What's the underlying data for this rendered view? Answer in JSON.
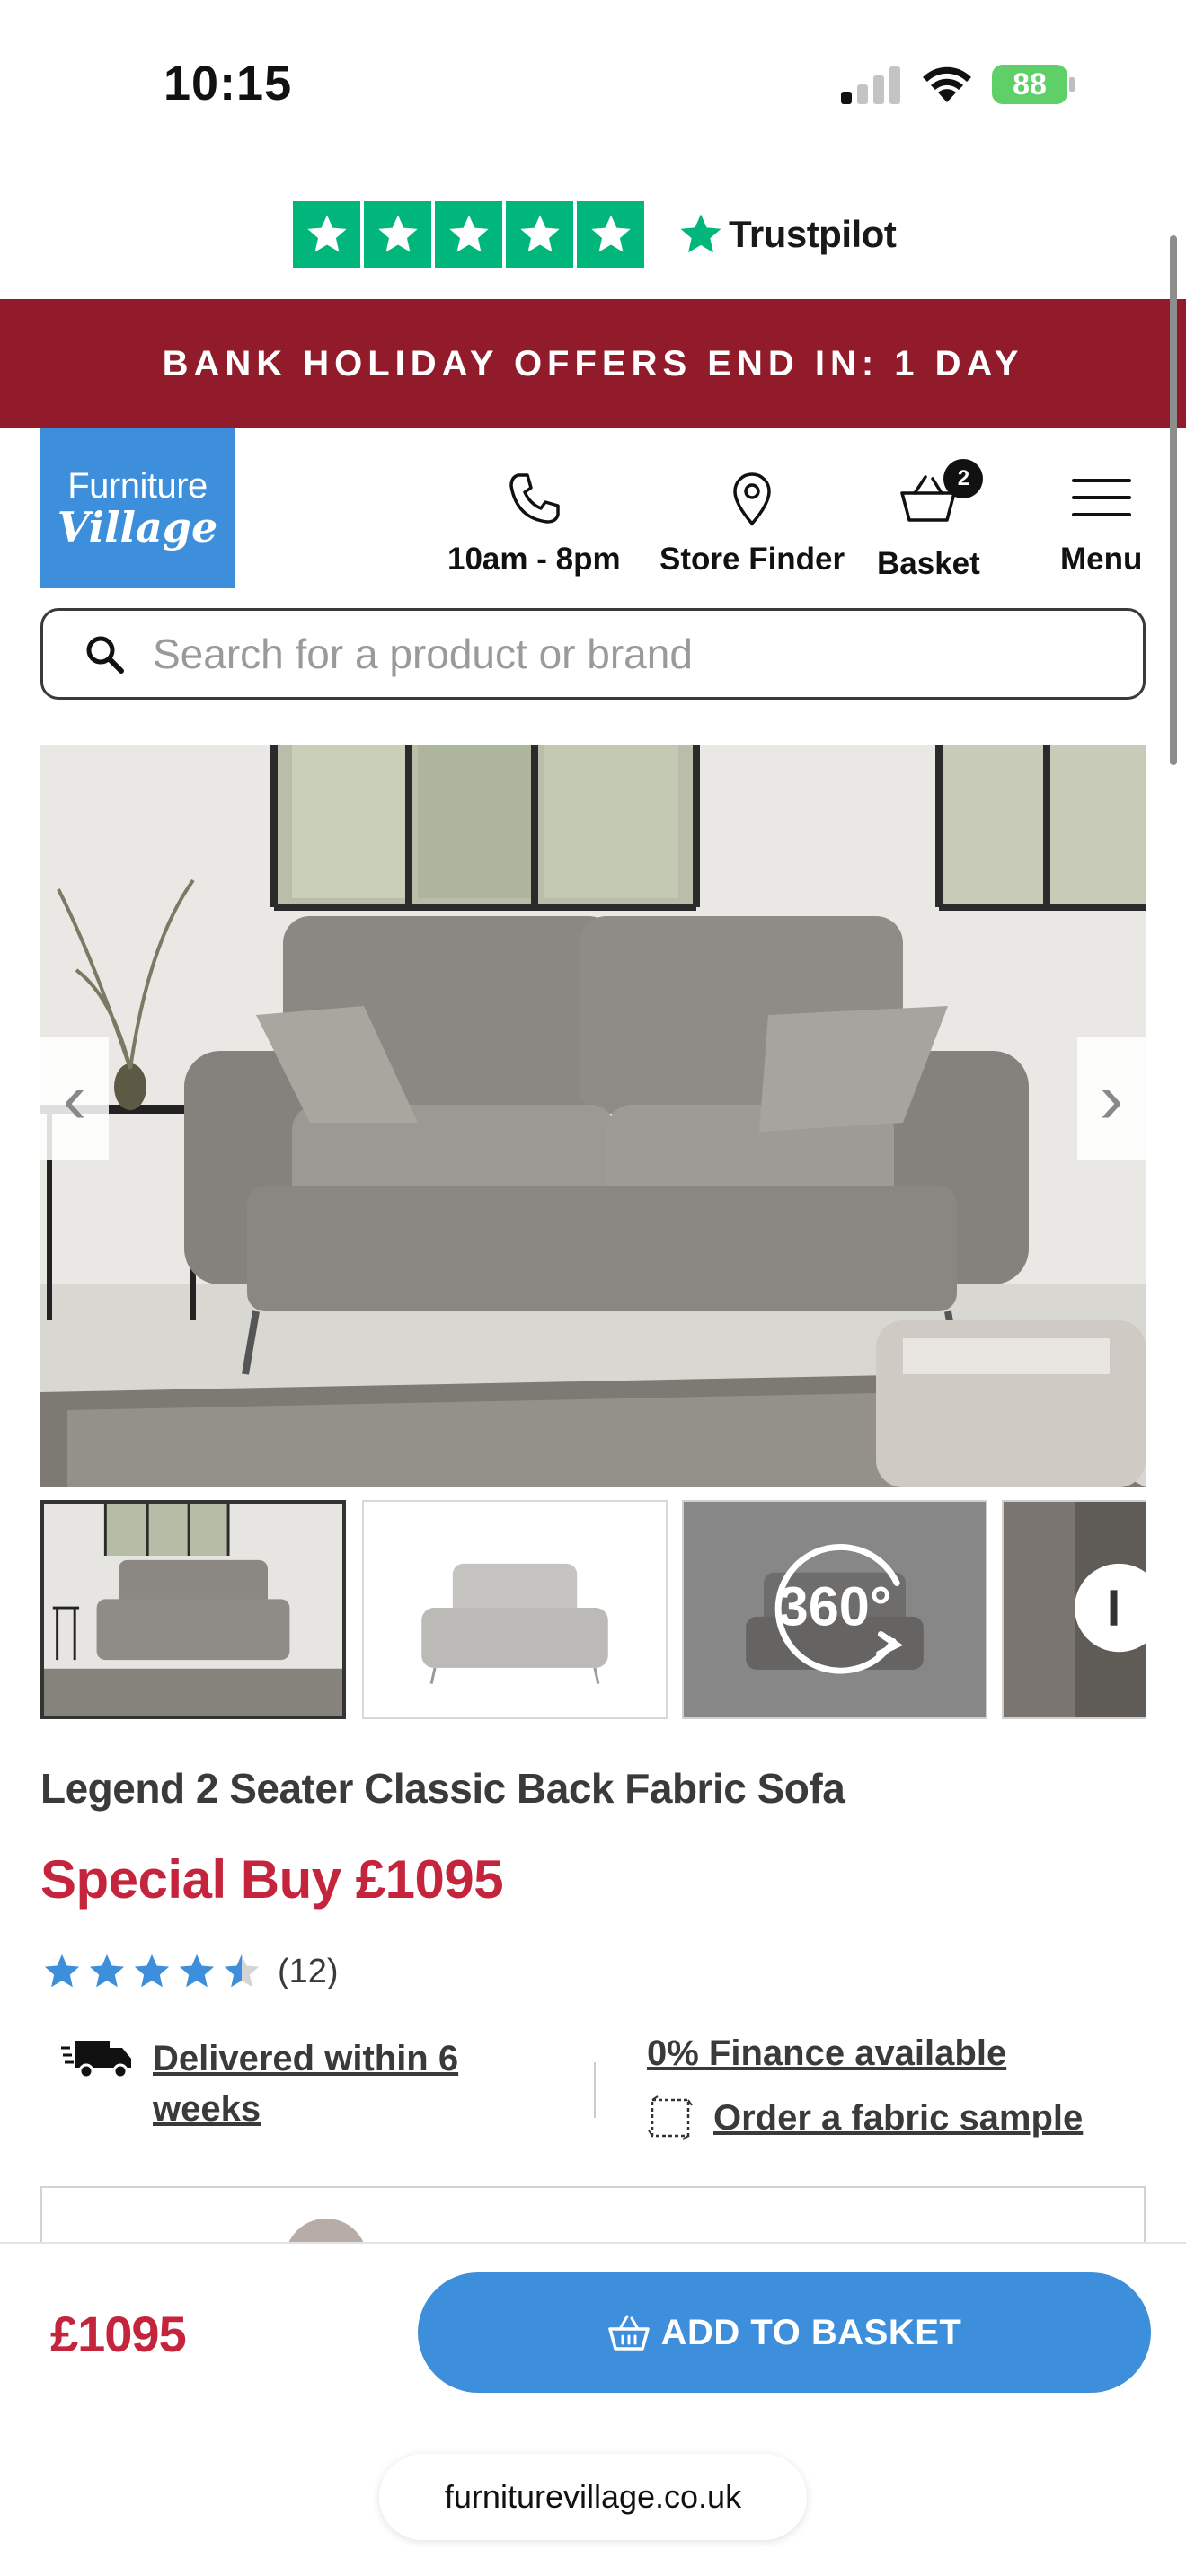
{
  "status_bar": {
    "time": "10:15",
    "battery": "88"
  },
  "trustpilot": {
    "brand": "Trustpilot",
    "star_color": "#00b67a"
  },
  "promo_banner": {
    "text": "BANK HOLIDAY OFFERS END IN: 1 DAY",
    "background": "#921b2b"
  },
  "header": {
    "logo_top": "Furniture",
    "logo_bottom": "Village",
    "logo_color": "#3d8fdb",
    "nav": [
      {
        "icon": "phone-icon",
        "label": "10am - 8pm"
      },
      {
        "icon": "location-pin-icon",
        "label": "Store Finder"
      },
      {
        "icon": "basket-icon",
        "label": "Basket",
        "badge": "2"
      },
      {
        "icon": "hamburger-menu-icon",
        "label": "Menu"
      }
    ]
  },
  "search": {
    "placeholder": "Search for a product or brand"
  },
  "gallery": {
    "prev_icon": "chevron-left-icon",
    "next_icon": "chevron-right-icon",
    "thumbnails": [
      {
        "kind": "lifestyle-photo",
        "selected": true
      },
      {
        "kind": "cutout-photo",
        "selected": false
      },
      {
        "kind": "360-view",
        "label": "360°",
        "selected": false
      },
      {
        "kind": "detail-photo",
        "selected": false
      }
    ]
  },
  "product": {
    "title": "Legend 2 Seater Classic Back Fabric Sofa",
    "price": "Special Buy £1095",
    "rating_value": 4.5,
    "rating_max": 5,
    "review_count": "(12)",
    "delivery": "Delivered within 6 weeks",
    "finance": "0% Finance available",
    "fabric_sample": "Order a fabric sample",
    "price_color": "#c4243c"
  },
  "sticky_bar": {
    "price": "£1095",
    "add_to_basket": "ADD TO BASKET",
    "button_color": "#3d8fdb"
  },
  "browser": {
    "url": "furniturevillage.co.uk"
  }
}
